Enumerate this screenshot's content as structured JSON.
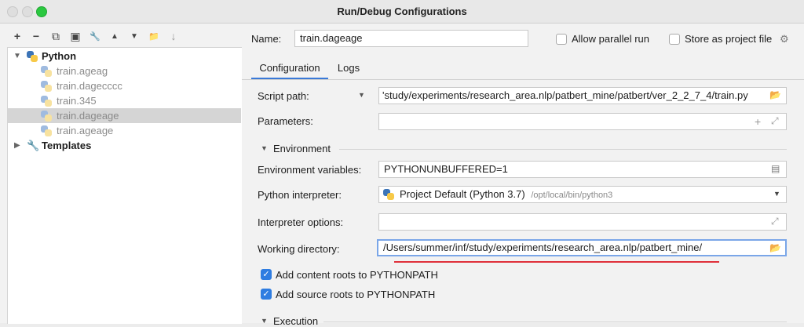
{
  "window": {
    "title": "Run/Debug Configurations"
  },
  "toolbar": {
    "add": "+",
    "remove": "−",
    "copy": "⧉",
    "save": "▣",
    "edit": "🔧",
    "up": "▲",
    "down": "▼",
    "folder": "📁",
    "sort": "↓"
  },
  "tree": {
    "python_label": "Python",
    "items": [
      {
        "label": "train.ageag"
      },
      {
        "label": "train.dagecccc"
      },
      {
        "label": "train.345"
      },
      {
        "label": "train.dageage"
      },
      {
        "label": "train.ageage"
      }
    ],
    "templates_label": "Templates"
  },
  "header": {
    "name_label": "Name:",
    "name_value": "train.dageage",
    "allow_parallel": "Allow parallel run",
    "store_project": "Store as project file"
  },
  "tabs": [
    {
      "label": "Configuration"
    },
    {
      "label": "Logs"
    }
  ],
  "config": {
    "script_path_label": "Script path:",
    "script_path_value": "'study/experiments/research_area.nlp/patbert_mine/patbert/ver_2_2_7_4/train.py",
    "parameters_label": "Parameters:",
    "parameters_value": "",
    "environment_label": "Environment",
    "env_vars_label": "Environment variables:",
    "env_vars_value": "PYTHONUNBUFFERED=1",
    "interpreter_label": "Python interpreter:",
    "interpreter_value": "Project Default (Python 3.7)",
    "interpreter_path": "/opt/local/bin/python3",
    "interp_options_label": "Interpreter options:",
    "interp_options_value": "",
    "workdir_label": "Working directory:",
    "workdir_value": "/Users/summer/inf/study/experiments/research_area.nlp/patbert_mine/",
    "content_roots": "Add content roots to PYTHONPATH",
    "source_roots": "Add source roots to PYTHONPATH",
    "execution_label": "Execution"
  },
  "colors": {
    "accent": "#2f7de1",
    "selection": "#d5d5d5",
    "underline": "#e0303a"
  }
}
